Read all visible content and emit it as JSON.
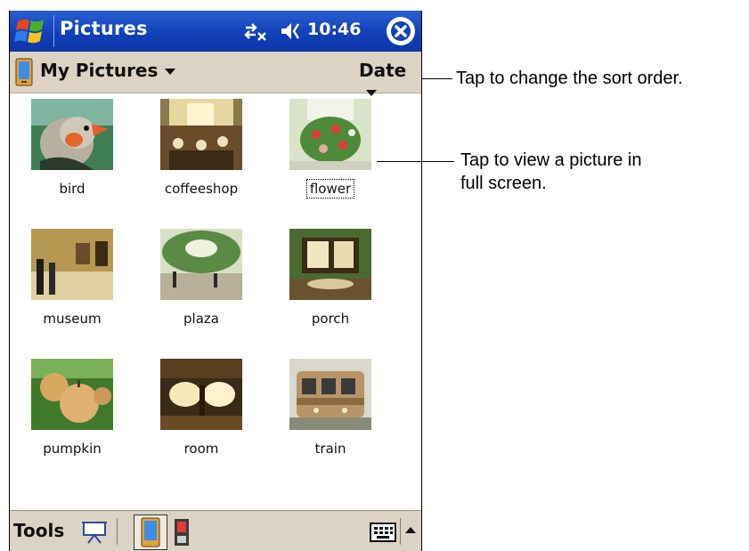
{
  "window": {
    "title": "Pictures",
    "clock": "10:46",
    "icons": {
      "start": "windows-flag-icon",
      "connectivity": "connectivity-icon",
      "volume": "speaker-icon",
      "close": "close-icon"
    }
  },
  "header": {
    "folder_label": "My Pictures",
    "sort_label": "Date"
  },
  "pictures": [
    {
      "name": "bird"
    },
    {
      "name": "coffeeshop"
    },
    {
      "name": "flower",
      "selected": true
    },
    {
      "name": "museum"
    },
    {
      "name": "plaza"
    },
    {
      "name": "porch"
    },
    {
      "name": "pumpkin"
    },
    {
      "name": "room"
    },
    {
      "name": "train"
    }
  ],
  "toolbar": {
    "tools_label": "Tools",
    "icons": [
      "slideshow-icon",
      "storage-device-icon",
      "storage-card-icon",
      "keyboard-icon",
      "input-menu-arrow-icon"
    ]
  },
  "callouts": {
    "sort": "Tap to change the sort order.",
    "view_line1": "Tap to view a picture in",
    "view_line2": "full screen."
  },
  "colors": {
    "titlebar": "#1240b8",
    "header_bg": "#dcd3c4",
    "background": "#ffffff"
  }
}
